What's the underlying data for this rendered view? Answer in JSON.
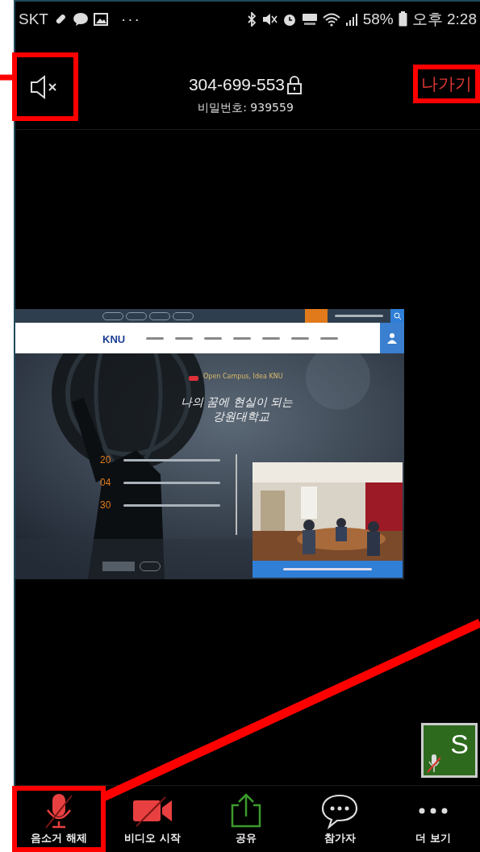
{
  "status_bar": {
    "carrier": "SKT",
    "more": "···",
    "battery": "58%",
    "time": "오후 2:28"
  },
  "meeting_header": {
    "speaker_muted": true,
    "speaker_highlighted": true,
    "meeting_id": "304-699-553",
    "locked": true,
    "password": "비밀번호: 939559",
    "leave_label": "나가기",
    "leave_highlighted": true
  },
  "shared_screen": {
    "logo": "KNU",
    "tagline": "Open Campus, Idea KNU",
    "slogan_lines": [
      "나의 꿈에 현실이 되는",
      "강원대학교"
    ],
    "news_days": [
      "20",
      "04",
      "30"
    ]
  },
  "participant_tile": {
    "initial": "S",
    "muted": true
  },
  "toolbar": [
    {
      "kind": "mic",
      "label": "음소거 해제",
      "off": true,
      "highlighted": true
    },
    {
      "kind": "video",
      "label": "비디오 시작",
      "off": true,
      "highlighted": false
    },
    {
      "kind": "share",
      "label": "공유",
      "highlighted": false
    },
    {
      "kind": "participants",
      "label": "참가자",
      "highlighted": false
    },
    {
      "kind": "more",
      "label": "더 보기",
      "highlighted": false
    }
  ]
}
